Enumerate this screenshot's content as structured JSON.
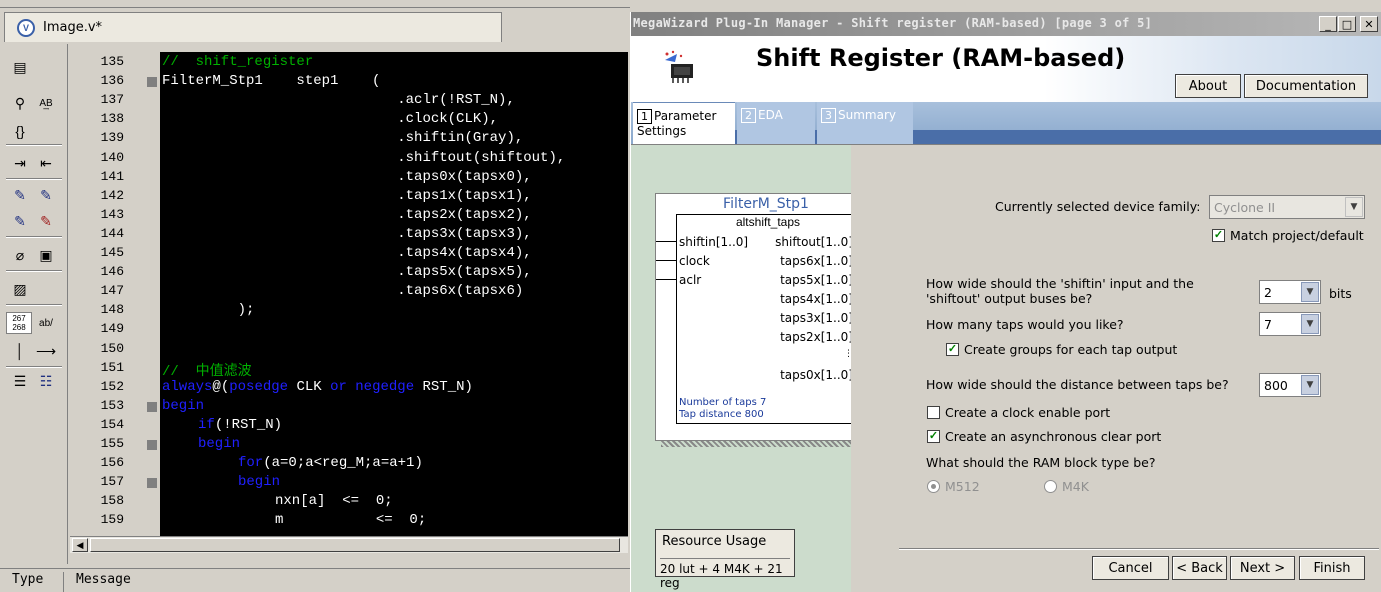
{
  "editor": {
    "tab_title": "Image.v*",
    "tab_icon": "verilog-file-icon",
    "line_numbers": [
      "135",
      "136",
      "137",
      "138",
      "139",
      "140",
      "141",
      "142",
      "143",
      "144",
      "145",
      "146",
      "147",
      "148",
      "149",
      "150",
      "151",
      "152",
      "153",
      "154",
      "155",
      "156",
      "157",
      "158",
      "159"
    ],
    "toolbar_labels": {
      "line_numbers_box": "267\n268",
      "ab_label": "ab/"
    },
    "lines": [
      {
        "text": "//  shift_register",
        "cls": "cmt"
      },
      {
        "text": "FilterM_Stp1    step1    (",
        "cls": ""
      },
      {
        "text": "                            .aclr(!RST_N),",
        "cls": ""
      },
      {
        "text": "                            .clock(CLK),",
        "cls": ""
      },
      {
        "text": "                            .shiftin(Gray),",
        "cls": ""
      },
      {
        "text": "                            .shiftout(shiftout),",
        "cls": ""
      },
      {
        "text": "                            .taps0x(tapsx0),",
        "cls": ""
      },
      {
        "text": "                            .taps1x(tapsx1),",
        "cls": ""
      },
      {
        "text": "                            .taps2x(tapsx2),",
        "cls": ""
      },
      {
        "text": "                            .taps3x(tapsx3),",
        "cls": ""
      },
      {
        "text": "                            .taps4x(tapsx4),",
        "cls": ""
      },
      {
        "text": "                            .taps5x(tapsx5),",
        "cls": ""
      },
      {
        "text": "                            .taps6x(tapsx6)",
        "cls": ""
      },
      {
        "text": "         );",
        "cls": ""
      },
      {
        "text": "",
        "cls": ""
      },
      {
        "text": "",
        "cls": ""
      },
      {
        "text": "//  中值滤波",
        "cls": "cmt"
      }
    ],
    "always_line": {
      "kw1": "always",
      "p1": "@(",
      "kw2": "posedge",
      "p2": " CLK ",
      "kw3": "or",
      "p3": " ",
      "kw4": "negedge",
      "p4": " RST_N)"
    },
    "begin1": "begin",
    "if_line": {
      "kw": "if",
      "rest": "(!RST_N)"
    },
    "begin2": "begin",
    "for_line": {
      "kw": "for",
      "rest": "(a=0;a<reg_M;a=a+1)"
    },
    "begin3": "begin",
    "assign1": "nxn[a]  <=  0;",
    "assign2": "m           <=  0;",
    "message_columns": [
      "Type",
      "Message"
    ]
  },
  "wizard": {
    "window_title": "MegaWizard Plug-In Manager - Shift register (RAM-based) [page 3 of 5]",
    "title": "Shift Register (RAM-based)",
    "buttons": {
      "about": "About",
      "documentation": "Documentation",
      "cancel": "Cancel",
      "back": "< Back",
      "next": "Next >",
      "finish": "Finish"
    },
    "window_buttons": {
      "minimize": "_",
      "maximize": "□",
      "close": "✕"
    },
    "tabs": [
      {
        "num": "1",
        "label": "Parameter Settings"
      },
      {
        "num": "2",
        "label": "EDA"
      },
      {
        "num": "3",
        "label": "Summary"
      }
    ],
    "symbol": {
      "name": "FilterM_Stp1",
      "subtitle": "altshift_taps",
      "left_ports": [
        "shiftin[1..0]",
        "clock",
        "aclr"
      ],
      "right_ports": [
        "shiftout[1..0]",
        "taps6x[1..0]",
        "taps5x[1..0]",
        "taps4x[1..0]",
        "taps3x[1..0]",
        "taps2x[1..0]",
        "taps0x[1..0]"
      ],
      "info1": "Number of taps 7",
      "info2": "Tap distance 800"
    },
    "resource": {
      "label": "Resource Usage",
      "value": "20 lut + 4 M4K + 21 reg"
    },
    "device_family_label": "Currently selected device family:",
    "device_family_value": "Cyclone II",
    "match_project": {
      "label": "Match project/default",
      "checked": true
    },
    "width_question": "How wide should the 'shiftin' input and the 'shiftout' output buses be?",
    "width_value": "2",
    "width_unit": "bits",
    "taps_question": "How many taps would you like?",
    "taps_value": "7",
    "groups": {
      "label": "Create groups for each tap output",
      "checked": true
    },
    "distance_question": "How wide should the distance between taps be?",
    "distance_value": "800",
    "clock_enable": {
      "label": "Create a clock enable port",
      "checked": false
    },
    "async_clear": {
      "label": "Create an asynchronous clear port",
      "checked": true
    },
    "ram_question": "What should the RAM block type be?",
    "ram_options": [
      {
        "label": "M512",
        "selected": true
      },
      {
        "label": "M4K",
        "selected": false
      }
    ]
  }
}
